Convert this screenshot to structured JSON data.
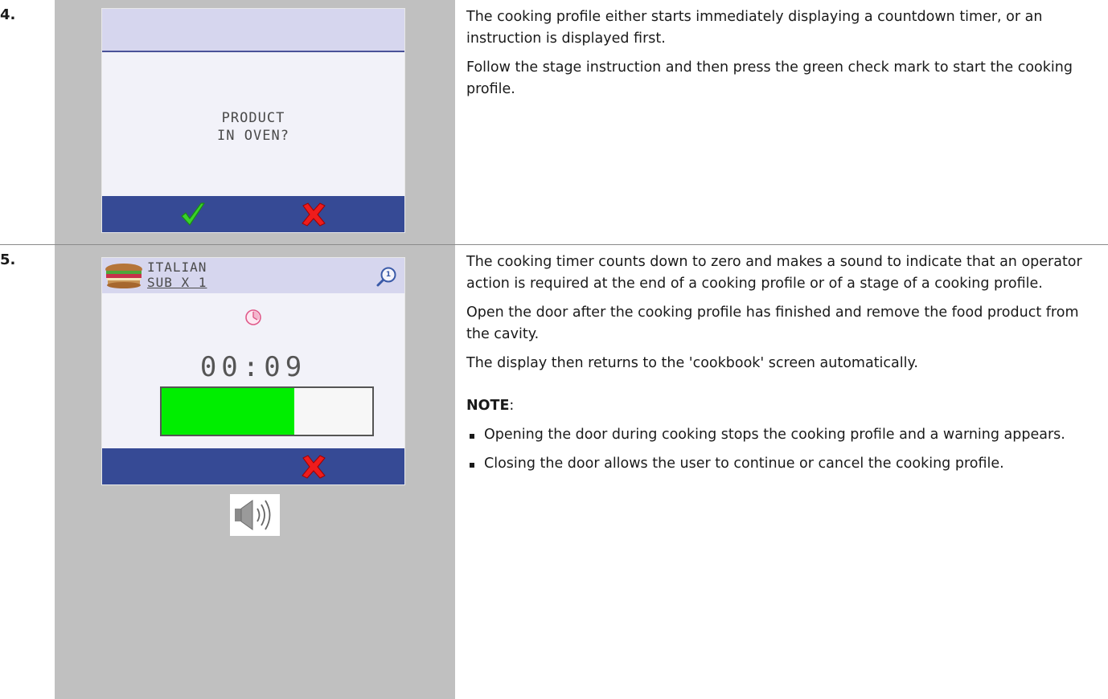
{
  "step4": {
    "number": "4.",
    "screen": {
      "prompt_line1": "PRODUCT",
      "prompt_line2": "IN OVEN?",
      "confirm_icon": "green-check-icon",
      "cancel_icon": "red-x-icon"
    },
    "paragraphs": [
      "The cooking profile either starts immediately displaying a countdown timer, or an instruction is displayed first.",
      "Follow the stage instruction and then press the green check mark to start the cooking profile."
    ]
  },
  "step5": {
    "number": "5.",
    "screen": {
      "title_line1": "ITALIAN",
      "title_line2": "SUB X 1",
      "stage_badge": "1",
      "timer": "00:09",
      "progress_percent": 63,
      "clock_icon": "stage-clock-icon",
      "cancel_icon": "red-x-icon"
    },
    "sound_icon": "speaker-sound-icon",
    "paragraphs": [
      "The cooking timer counts down to zero and makes a sound to indicate that an operator action is required at the end of a cooking profile or of a stage of a cooking profile.",
      "Open the door after the cooking profile has finished and remove the food product from the cavity.",
      "The display then returns to the 'cookbook' screen automatically."
    ],
    "note_label": "NOTE",
    "note_colon": ":",
    "notes": [
      "Opening the door during cooking stops the cooking profile and a warning appears.",
      "Closing the door allows the user to continue or cancel the cooking profile."
    ]
  },
  "colors": {
    "header": "#d6d6ee",
    "footer": "#364a95",
    "progress": "#00ee00",
    "cell_bg": "#c0c0c0"
  }
}
